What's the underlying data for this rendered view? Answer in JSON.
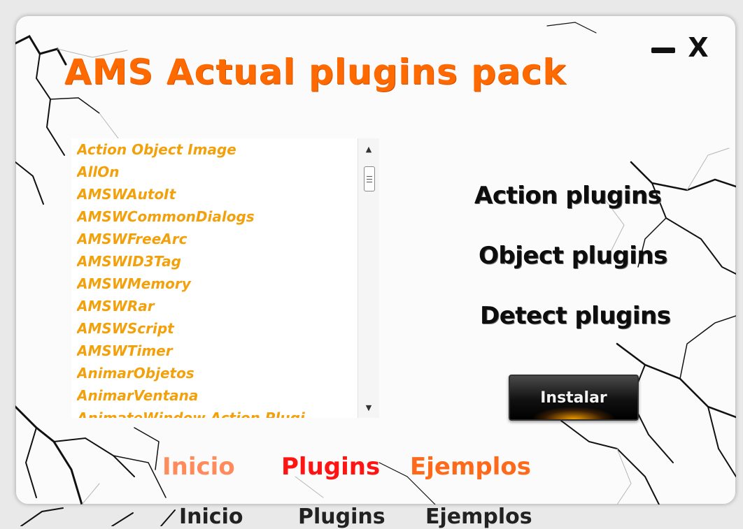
{
  "app": {
    "title": "AMS Actual plugins pack",
    "minimize_symbol": "—",
    "close_symbol": "X"
  },
  "plugin_list": {
    "items": [
      "Action Object Image",
      "AllOn",
      "AMSWAutoIt",
      "AMSWCommonDialogs",
      "AMSWFreeArc",
      "AMSWID3Tag",
      "AMSWMemory",
      "AMSWRar",
      "AMSWScript",
      "AMSWTimer",
      "AnimarObjetos",
      "AnimarVentana",
      "AnimateWindow Action Plugi"
    ],
    "scroll_up_icon": "▲",
    "scroll_down_icon": "▼"
  },
  "categories": {
    "action": "Action plugins",
    "object": "Object plugins",
    "detect": "Detect plugins"
  },
  "install_button": "Instalar",
  "nav": {
    "inicio": "Inicio",
    "plugins": "Plugins",
    "ejemplos": "Ejemplos"
  },
  "ghost_nav": {
    "inicio": "Inicio",
    "plugins": "Plugins",
    "ejemplos": "Ejemplos"
  },
  "colors": {
    "title": "#ff6a00",
    "list_text": "#f2a10c",
    "nav_inicio": "#ff8a5c",
    "nav_plugins": "#ff1414",
    "nav_ejemplos": "#ff6a1a"
  }
}
